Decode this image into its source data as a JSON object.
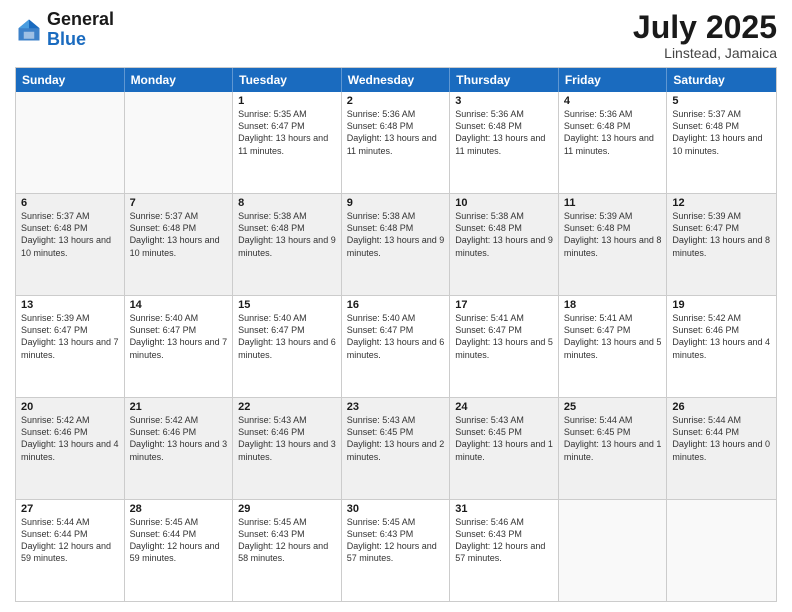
{
  "header": {
    "logo_general": "General",
    "logo_blue": "Blue",
    "month": "July 2025",
    "location": "Linstead, Jamaica"
  },
  "calendar": {
    "days_of_week": [
      "Sunday",
      "Monday",
      "Tuesday",
      "Wednesday",
      "Thursday",
      "Friday",
      "Saturday"
    ],
    "weeks": [
      [
        {
          "day": "",
          "info": "",
          "empty": true
        },
        {
          "day": "",
          "info": "",
          "empty": true
        },
        {
          "day": "1",
          "info": "Sunrise: 5:35 AM\nSunset: 6:47 PM\nDaylight: 13 hours and 11 minutes."
        },
        {
          "day": "2",
          "info": "Sunrise: 5:36 AM\nSunset: 6:48 PM\nDaylight: 13 hours and 11 minutes."
        },
        {
          "day": "3",
          "info": "Sunrise: 5:36 AM\nSunset: 6:48 PM\nDaylight: 13 hours and 11 minutes."
        },
        {
          "day": "4",
          "info": "Sunrise: 5:36 AM\nSunset: 6:48 PM\nDaylight: 13 hours and 11 minutes."
        },
        {
          "day": "5",
          "info": "Sunrise: 5:37 AM\nSunset: 6:48 PM\nDaylight: 13 hours and 10 minutes."
        }
      ],
      [
        {
          "day": "6",
          "info": "Sunrise: 5:37 AM\nSunset: 6:48 PM\nDaylight: 13 hours and 10 minutes.",
          "shaded": true
        },
        {
          "day": "7",
          "info": "Sunrise: 5:37 AM\nSunset: 6:48 PM\nDaylight: 13 hours and 10 minutes.",
          "shaded": true
        },
        {
          "day": "8",
          "info": "Sunrise: 5:38 AM\nSunset: 6:48 PM\nDaylight: 13 hours and 9 minutes.",
          "shaded": true
        },
        {
          "day": "9",
          "info": "Sunrise: 5:38 AM\nSunset: 6:48 PM\nDaylight: 13 hours and 9 minutes.",
          "shaded": true
        },
        {
          "day": "10",
          "info": "Sunrise: 5:38 AM\nSunset: 6:48 PM\nDaylight: 13 hours and 9 minutes.",
          "shaded": true
        },
        {
          "day": "11",
          "info": "Sunrise: 5:39 AM\nSunset: 6:48 PM\nDaylight: 13 hours and 8 minutes.",
          "shaded": true
        },
        {
          "day": "12",
          "info": "Sunrise: 5:39 AM\nSunset: 6:47 PM\nDaylight: 13 hours and 8 minutes.",
          "shaded": true
        }
      ],
      [
        {
          "day": "13",
          "info": "Sunrise: 5:39 AM\nSunset: 6:47 PM\nDaylight: 13 hours and 7 minutes."
        },
        {
          "day": "14",
          "info": "Sunrise: 5:40 AM\nSunset: 6:47 PM\nDaylight: 13 hours and 7 minutes."
        },
        {
          "day": "15",
          "info": "Sunrise: 5:40 AM\nSunset: 6:47 PM\nDaylight: 13 hours and 6 minutes."
        },
        {
          "day": "16",
          "info": "Sunrise: 5:40 AM\nSunset: 6:47 PM\nDaylight: 13 hours and 6 minutes."
        },
        {
          "day": "17",
          "info": "Sunrise: 5:41 AM\nSunset: 6:47 PM\nDaylight: 13 hours and 5 minutes."
        },
        {
          "day": "18",
          "info": "Sunrise: 5:41 AM\nSunset: 6:47 PM\nDaylight: 13 hours and 5 minutes."
        },
        {
          "day": "19",
          "info": "Sunrise: 5:42 AM\nSunset: 6:46 PM\nDaylight: 13 hours and 4 minutes."
        }
      ],
      [
        {
          "day": "20",
          "info": "Sunrise: 5:42 AM\nSunset: 6:46 PM\nDaylight: 13 hours and 4 minutes.",
          "shaded": true
        },
        {
          "day": "21",
          "info": "Sunrise: 5:42 AM\nSunset: 6:46 PM\nDaylight: 13 hours and 3 minutes.",
          "shaded": true
        },
        {
          "day": "22",
          "info": "Sunrise: 5:43 AM\nSunset: 6:46 PM\nDaylight: 13 hours and 3 minutes.",
          "shaded": true
        },
        {
          "day": "23",
          "info": "Sunrise: 5:43 AM\nSunset: 6:45 PM\nDaylight: 13 hours and 2 minutes.",
          "shaded": true
        },
        {
          "day": "24",
          "info": "Sunrise: 5:43 AM\nSunset: 6:45 PM\nDaylight: 13 hours and 1 minute.",
          "shaded": true
        },
        {
          "day": "25",
          "info": "Sunrise: 5:44 AM\nSunset: 6:45 PM\nDaylight: 13 hours and 1 minute.",
          "shaded": true
        },
        {
          "day": "26",
          "info": "Sunrise: 5:44 AM\nSunset: 6:44 PM\nDaylight: 13 hours and 0 minutes.",
          "shaded": true
        }
      ],
      [
        {
          "day": "27",
          "info": "Sunrise: 5:44 AM\nSunset: 6:44 PM\nDaylight: 12 hours and 59 minutes."
        },
        {
          "day": "28",
          "info": "Sunrise: 5:45 AM\nSunset: 6:44 PM\nDaylight: 12 hours and 59 minutes."
        },
        {
          "day": "29",
          "info": "Sunrise: 5:45 AM\nSunset: 6:43 PM\nDaylight: 12 hours and 58 minutes."
        },
        {
          "day": "30",
          "info": "Sunrise: 5:45 AM\nSunset: 6:43 PM\nDaylight: 12 hours and 57 minutes."
        },
        {
          "day": "31",
          "info": "Sunrise: 5:46 AM\nSunset: 6:43 PM\nDaylight: 12 hours and 57 minutes."
        },
        {
          "day": "",
          "info": "",
          "empty": true
        },
        {
          "day": "",
          "info": "",
          "empty": true
        }
      ]
    ]
  }
}
